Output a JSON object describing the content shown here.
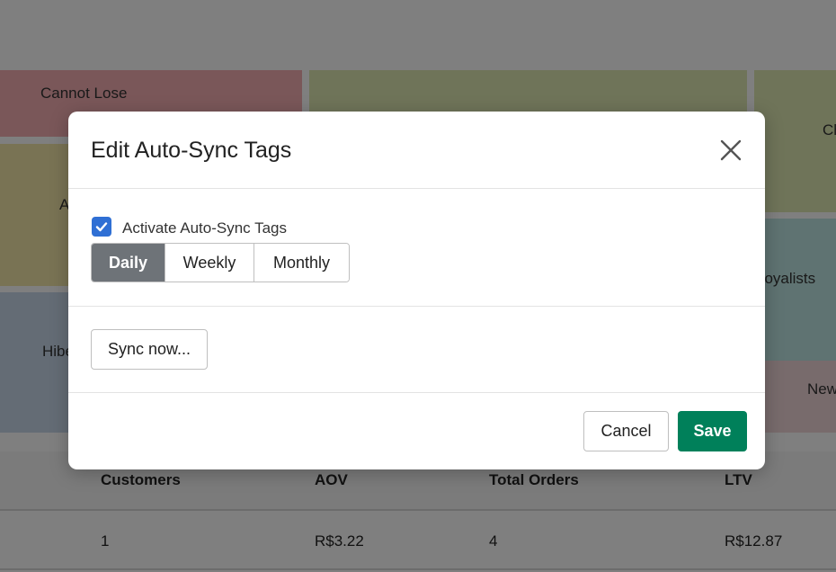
{
  "background": {
    "segments": [
      {
        "key": "cannot",
        "label": "Cannot Lose"
      },
      {
        "key": "green",
        "label": ""
      },
      {
        "key": "champ",
        "label": "Ch"
      },
      {
        "key": "atrisk",
        "label": "A"
      },
      {
        "key": "loyal",
        "label": "Loyalists"
      },
      {
        "key": "hiber",
        "label": "Hibe"
      },
      {
        "key": "new",
        "label": "New"
      }
    ],
    "table": {
      "headers": [
        "Customers",
        "AOV",
        "Total Orders",
        "LTV"
      ],
      "rows": [
        [
          "1",
          "R$3.22",
          "4",
          "R$12.87"
        ]
      ]
    }
  },
  "modal": {
    "title": "Edit Auto-Sync Tags",
    "close_icon": "close-x-icon",
    "checkbox": {
      "label": "Activate Auto-Sync Tags",
      "checked": true
    },
    "frequency": {
      "options": [
        "Daily",
        "Weekly",
        "Monthly"
      ],
      "selected": "Daily"
    },
    "sync_now_label": "Sync now...",
    "cancel_label": "Cancel",
    "save_label": "Save"
  },
  "colors": {
    "checkbox": "#2f6fd4",
    "segment_active": "#6e7378",
    "save": "#00805a",
    "overlay": "rgba(0,0,0,0.5)"
  }
}
